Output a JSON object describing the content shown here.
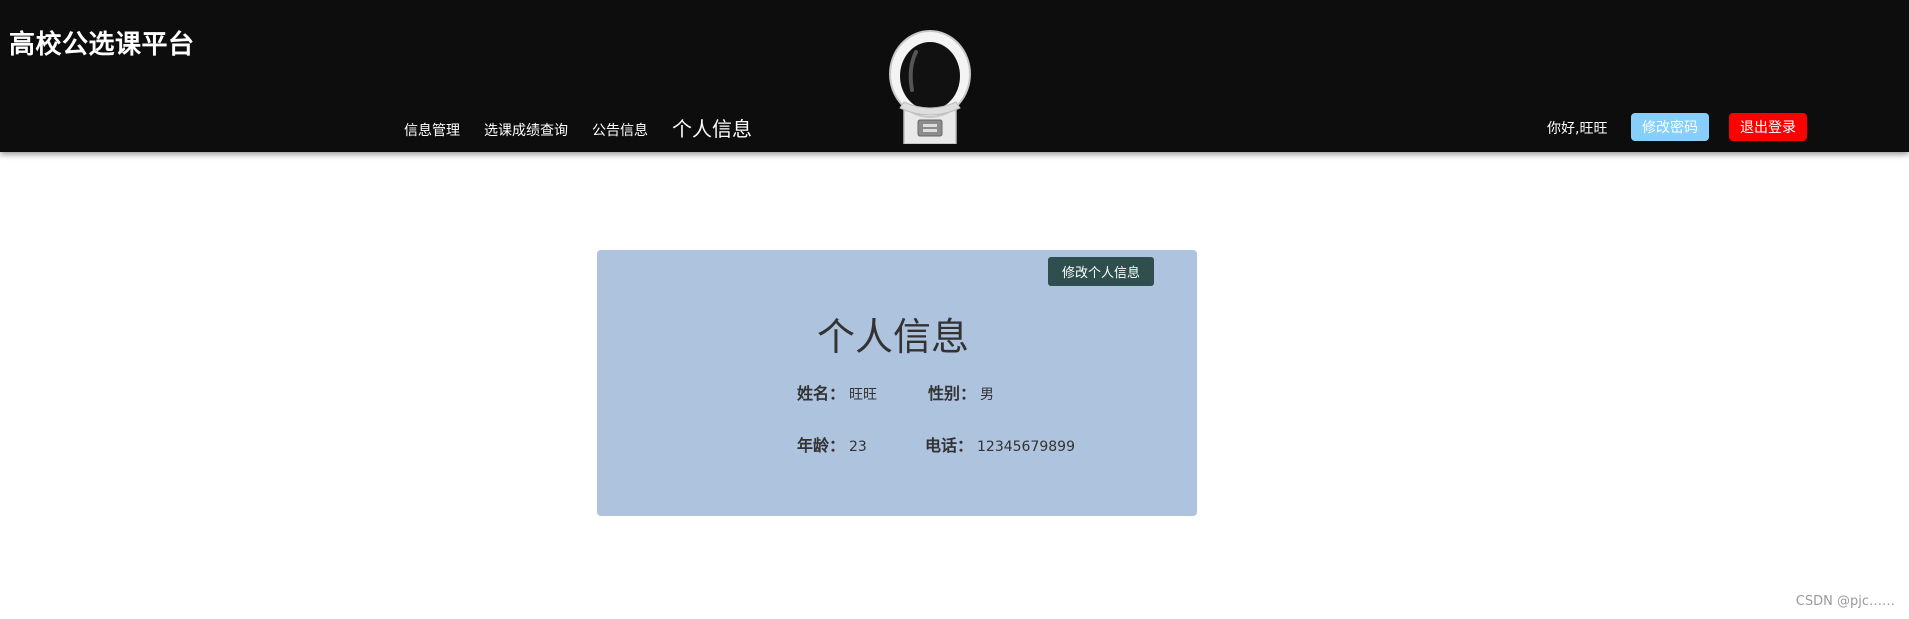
{
  "header": {
    "brand": "高校公选课平台",
    "nav": [
      {
        "label": "信息管理"
      },
      {
        "label": "选课成绩查询"
      },
      {
        "label": "公告信息"
      },
      {
        "label": "个人信息"
      }
    ],
    "greeting": "你好,旺旺",
    "change_password_label": "修改密码",
    "logout_label": "退出登录"
  },
  "profile": {
    "edit_button_label": "修改个人信息",
    "title": "个人信息",
    "fields": [
      {
        "label": "姓名：",
        "value": "旺旺"
      },
      {
        "label": "性别：",
        "value": "男"
      },
      {
        "label": "年龄：",
        "value": "23"
      },
      {
        "label": "电话：",
        "value": "12345679899"
      }
    ]
  },
  "watermark": "CSDN @pjc……",
  "colors": {
    "header_bg": "#0d0d0d",
    "change_password_bg": "#87cefa",
    "logout_bg": "#ff0000",
    "card_bg": "#aec3dd",
    "edit_button_bg": "#2f4f4f"
  },
  "icons": {
    "mascot": "astronaut-icon"
  }
}
